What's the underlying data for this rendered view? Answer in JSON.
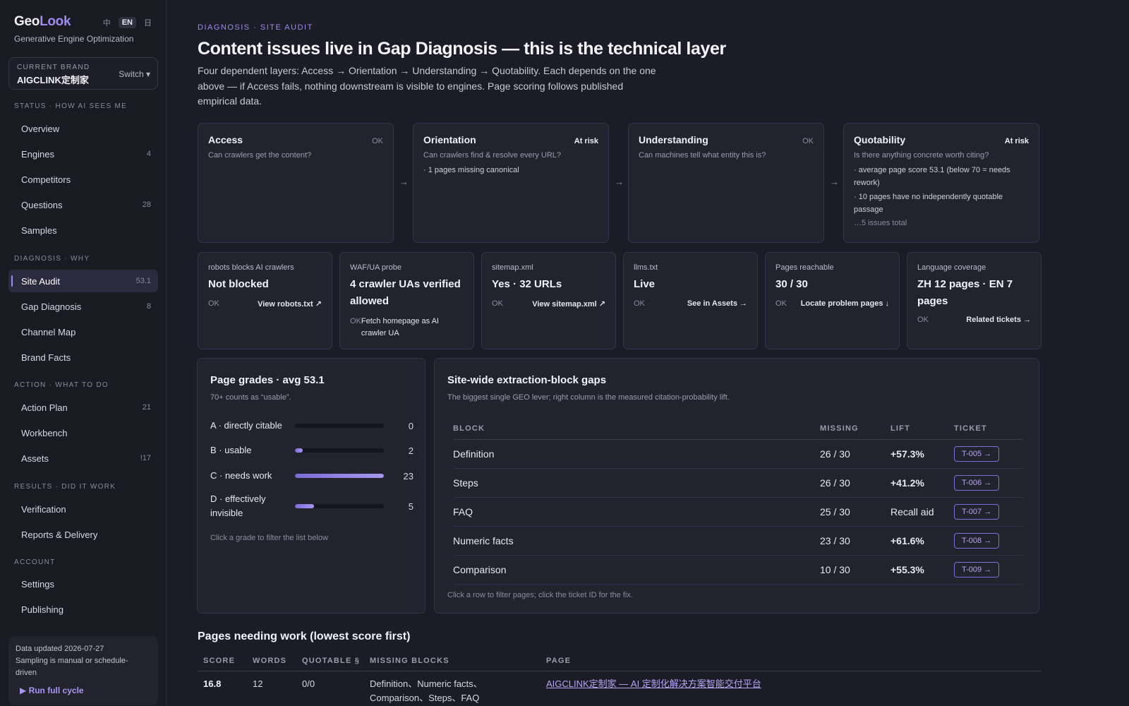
{
  "app": {
    "logo_a": "Geo",
    "logo_b": "Look",
    "tagline": "Generative Engine Optimization",
    "lang_zh": "中",
    "lang_en": "EN",
    "lang_icon": "日"
  },
  "brand": {
    "caption": "CURRENT BRAND",
    "name": "AIGCLINK定制家",
    "switch": "Switch ▾"
  },
  "nav": {
    "status_header": "STATUS · HOW AI SEES ME",
    "diagnosis_header": "DIAGNOSIS · WHY",
    "action_header": "ACTION · WHAT TO DO",
    "results_header": "RESULTS · DID IT WORK",
    "account_header": "ACCOUNT",
    "items": [
      {
        "label": "Overview",
        "count": ""
      },
      {
        "label": "Engines",
        "count": "4"
      },
      {
        "label": "Competitors",
        "count": ""
      },
      {
        "label": "Questions",
        "count": "28"
      },
      {
        "label": "Samples",
        "count": ""
      },
      {
        "label": "Site Audit",
        "count": "53.1"
      },
      {
        "label": "Gap Diagnosis",
        "count": "8"
      },
      {
        "label": "Channel Map",
        "count": ""
      },
      {
        "label": "Brand Facts",
        "count": ""
      },
      {
        "label": "Action Plan",
        "count": "21"
      },
      {
        "label": "Workbench",
        "count": ""
      },
      {
        "label": "Assets",
        "count": "!17"
      },
      {
        "label": "Verification",
        "count": ""
      },
      {
        "label": "Reports & Delivery",
        "count": ""
      },
      {
        "label": "Settings",
        "count": ""
      },
      {
        "label": "Publishing",
        "count": ""
      }
    ]
  },
  "footer": {
    "updated": "Data updated 2026-07-27",
    "sampling_1": "Sampling is manual or schedule-",
    "sampling_2": "driven",
    "run": "▶ Run full cycle"
  },
  "header": {
    "eyebrow": "DIAGNOSIS · SITE AUDIT",
    "title": "Content issues live in Gap Diagnosis — this is the technical layer",
    "subtitle": "Four dependent layers: Access → Orientation → Understanding → Quotability. Each depends on the one above — if Access fails, nothing downstream is visible to engines. Page scoring follows published empirical data."
  },
  "layers": [
    {
      "title": "Access",
      "status": "OK",
      "question": "Can crawlers get the content?",
      "issues": []
    },
    {
      "title": "Orientation",
      "status": "At risk",
      "question": "Can crawlers find & resolve every URL?",
      "issues": [
        "· 1 pages missing canonical"
      ]
    },
    {
      "title": "Understanding",
      "status": "OK",
      "question": "Can machines tell what entity this is?",
      "issues": []
    },
    {
      "title": "Quotability",
      "status": "At risk",
      "question": "Is there anything concrete worth citing?",
      "issues": [
        "· average page score 53.1 (below 70 = needs rework)",
        "· 10 pages have no independently quotable passage"
      ],
      "more": "…5 issues total"
    }
  ],
  "checks": [
    {
      "label": "robots blocks AI crawlers",
      "value": "Not blocked",
      "ok": "OK",
      "link": "View robots.txt ↗"
    },
    {
      "label": "WAF/UA probe",
      "value": "4 crawler UAs verified allowed",
      "ok": "OK",
      "link": "Fetch homepage as AI crawler UA"
    },
    {
      "label": "sitemap.xml",
      "value": "Yes · 32 URLs",
      "ok": "OK",
      "link": "View sitemap.xml ↗"
    },
    {
      "label": "llms.txt",
      "value": "Live",
      "ok": "OK",
      "link": "See in Assets →"
    },
    {
      "label": "Pages reachable",
      "value": "30 / 30",
      "ok": "OK",
      "link": "Locate problem pages ↓"
    },
    {
      "label": "Language coverage",
      "value": "ZH 12 pages · EN 7 pages",
      "ok": "OK",
      "link": "Related tickets →"
    }
  ],
  "grades": {
    "title": "Page grades · avg 53.1",
    "subtitle": "70+ counts as “usable”.",
    "max": 23,
    "rows": [
      {
        "label": "A · directly citable",
        "count": 0
      },
      {
        "label": "B · usable",
        "count": 2
      },
      {
        "label": "C · needs work",
        "count": 23
      },
      {
        "label": "D · effectively invisible",
        "count": 5
      }
    ],
    "hint": "Click a grade to filter the list below"
  },
  "gaps": {
    "title": "Site-wide extraction-block gaps",
    "subtitle": "The biggest single GEO lever; right column is the measured citation-probability lift.",
    "columns": [
      "BLOCK",
      "MISSING",
      "LIFT",
      "TICKET"
    ],
    "rows": [
      {
        "block": "Definition",
        "missing": "26 / 30",
        "lift": "+57.3%",
        "ticket": "T-005 →"
      },
      {
        "block": "Steps",
        "missing": "26 / 30",
        "lift": "+41.2%",
        "ticket": "T-006 →"
      },
      {
        "block": "FAQ",
        "missing": "25 / 30",
        "lift": "Recall aid",
        "ticket": "T-007 →"
      },
      {
        "block": "Numeric facts",
        "missing": "23 / 30",
        "lift": "+61.6%",
        "ticket": "T-008 →"
      },
      {
        "block": "Comparison",
        "missing": "10 / 30",
        "lift": "+55.3%",
        "ticket": "T-009 →"
      }
    ],
    "hint": "Click a row to filter pages; click the ticket ID for the fix."
  },
  "pages": {
    "title": "Pages needing work (lowest score first)",
    "columns": [
      "SCORE",
      "WORDS",
      "QUOTABLE §",
      "MISSING BLOCKS",
      "PAGE"
    ],
    "rows": [
      {
        "score": "16.8",
        "words": "12",
        "quotable": "0/0",
        "missing_1": "Definition、Numeric facts、",
        "missing_2": "Comparison、Steps、FAQ",
        "page": "AIGCLINK定制家 — AI 定制化解决方案智能交付平台"
      }
    ]
  }
}
